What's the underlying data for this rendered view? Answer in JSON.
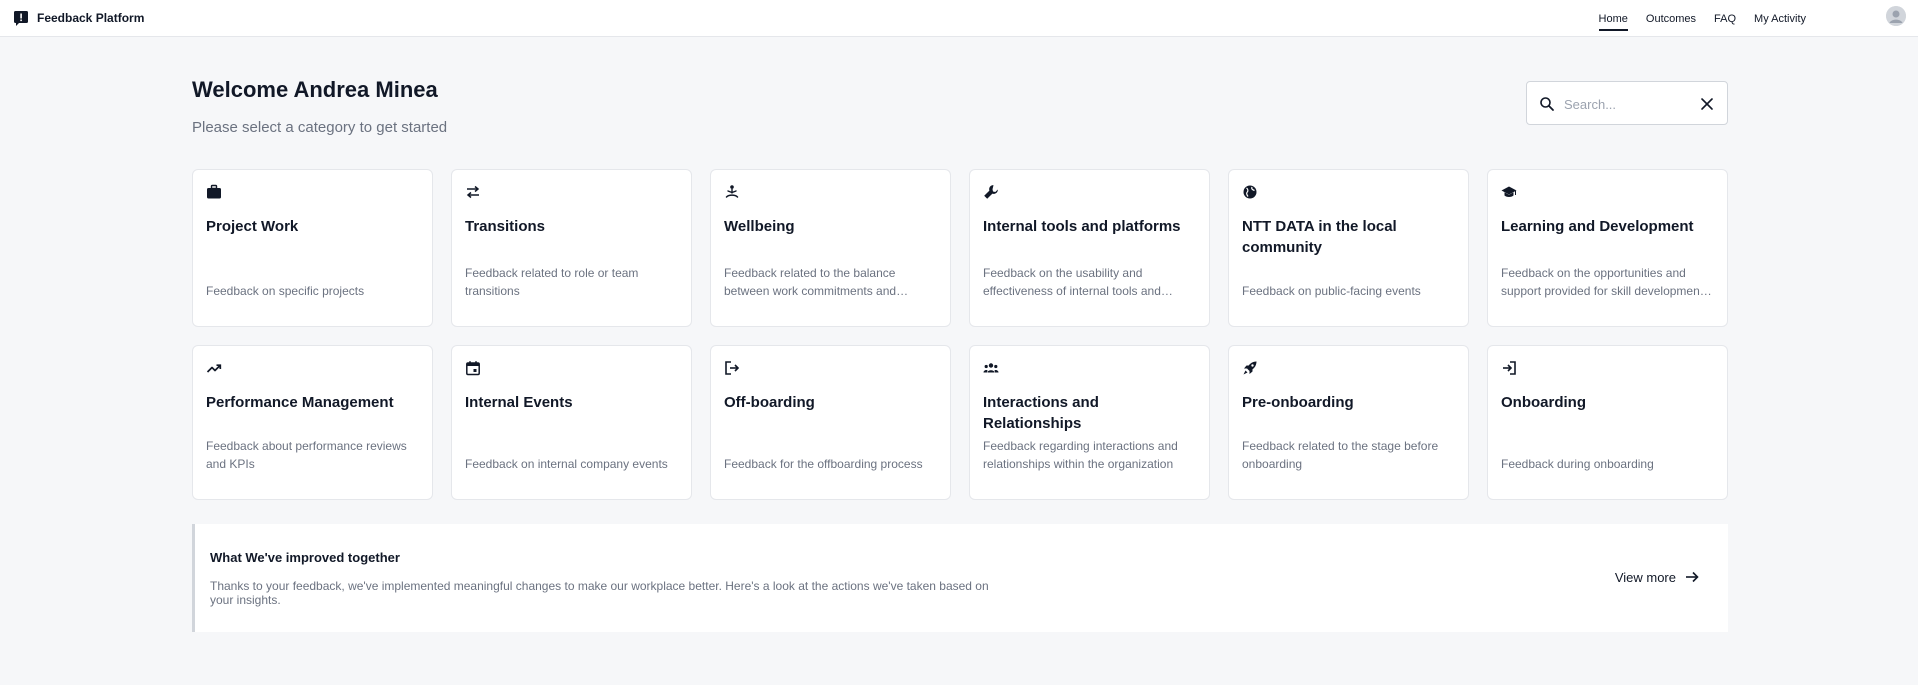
{
  "app": {
    "title": "Feedback Platform"
  },
  "nav": {
    "items": [
      {
        "label": "Home",
        "active": true
      },
      {
        "label": "Outcomes",
        "active": false
      },
      {
        "label": "FAQ",
        "active": false
      },
      {
        "label": "My Activity",
        "active": false
      }
    ]
  },
  "header": {
    "welcome": "Welcome Andrea Minea",
    "subtitle": "Please select a category to get started"
  },
  "search": {
    "placeholder": "Search...",
    "value": ""
  },
  "categories": [
    {
      "title": "Project Work",
      "description": "Feedback on specific projects",
      "icon": "briefcase-icon"
    },
    {
      "title": "Transitions",
      "description": "Feedback related to role or team transitions",
      "icon": "swap-arrows-icon"
    },
    {
      "title": "Wellbeing",
      "description": "Feedback related to the balance between work commitments and personal life",
      "icon": "meditation-icon"
    },
    {
      "title": "Internal tools and platforms",
      "description": "Feedback on the usability and effectiveness of internal tools and platforms",
      "icon": "wrench-icon"
    },
    {
      "title": "NTT DATA in the local community",
      "description": "Feedback on public-facing events",
      "icon": "globe-icon"
    },
    {
      "title": "Learning and Development",
      "description": "Feedback on the opportunities and support provided for skill development and growth",
      "icon": "graduation-cap-icon"
    },
    {
      "title": "Performance Management",
      "description": "Feedback about performance reviews and KPIs",
      "icon": "trending-up-icon"
    },
    {
      "title": "Internal Events",
      "description": "Feedback on internal company events",
      "icon": "calendar-event-icon"
    },
    {
      "title": "Off-boarding",
      "description": "Feedback for the offboarding process",
      "icon": "logout-icon"
    },
    {
      "title": "Interactions and Relationships",
      "description": "Feedback regarding interactions and relationships within the organization",
      "icon": "people-icon"
    },
    {
      "title": "Pre-onboarding",
      "description": "Feedback related to the stage before onboarding",
      "icon": "rocket-icon"
    },
    {
      "title": "Onboarding",
      "description": "Feedback during onboarding",
      "icon": "login-icon"
    }
  ],
  "banner": {
    "title": "What We've improved together",
    "text": "Thanks to your feedback, we've implemented meaningful changes to make our workplace better. Here's a look at the actions we've taken based on your insights.",
    "cta": "View more"
  },
  "colors": {
    "background": "#f6f7f9",
    "text": "#111827",
    "muted": "#6b7280",
    "border": "#e5e7eb"
  }
}
